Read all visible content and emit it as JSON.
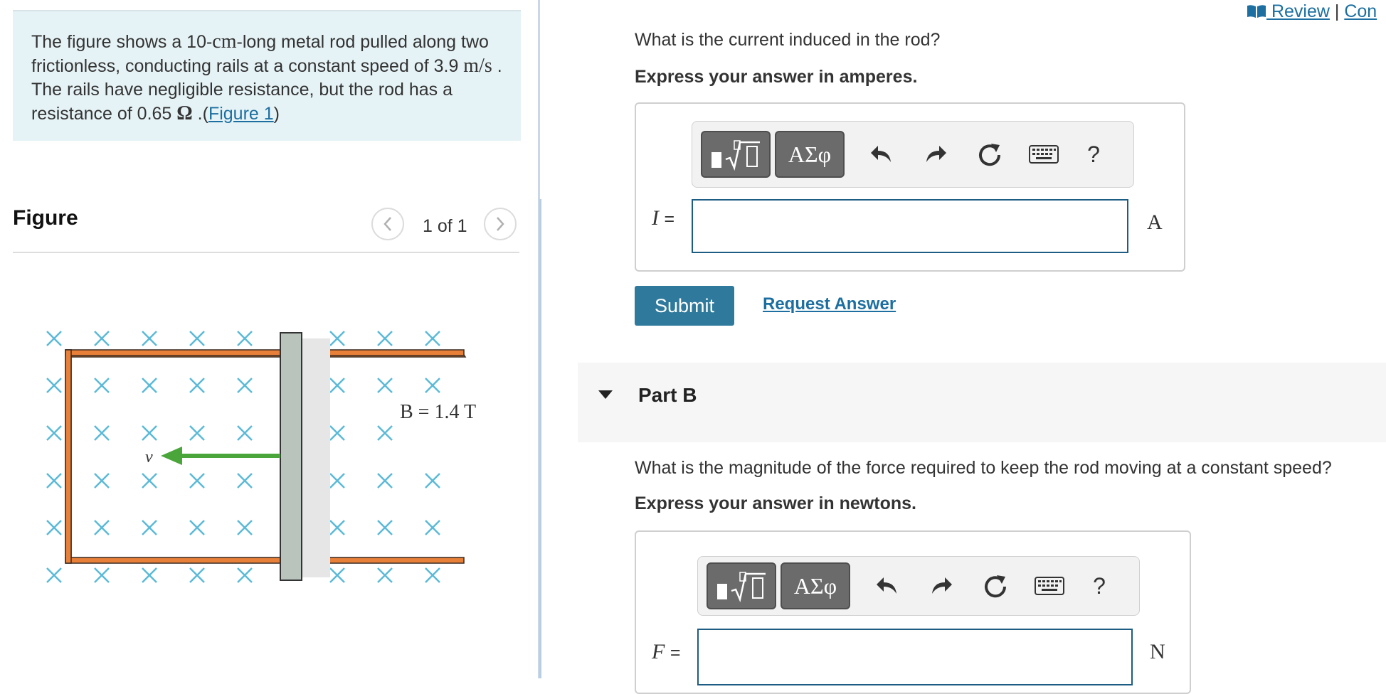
{
  "problem": {
    "text_1": "The figure shows a 10-",
    "unit_cm": "cm",
    "text_2": "-long metal rod pulled along two frictionless, conducting rails at a constant speed of 3.9 ",
    "unit_speed": "m/s",
    "text_3": " . The rails have negligible resistance, but the rod has a resistance of 0.65 ",
    "unit_ohm": "Ω",
    "text_4": " .(",
    "figure_link": "Figure 1",
    "text_5": ")"
  },
  "figure": {
    "heading": "Figure",
    "pager_text": "1 of 1",
    "prev_icon": "chevron-left-icon",
    "next_icon": "chevron-right-icon",
    "field_label": "B = 1.4 T",
    "velocity_label": "v",
    "colors": {
      "rail": "#e8803a",
      "rod": "#b9c4bd",
      "field_x": "#5bbad8",
      "arrow": "#4aa63a"
    }
  },
  "header": {
    "review_icon": "book-icon",
    "review_label": " Review",
    "separator": " | ",
    "constants_label": "Con"
  },
  "part_a": {
    "question": "What is the current induced in the rod?",
    "instruction": "Express your answer in amperes.",
    "variable": "I",
    "equals": "=",
    "unit": "A",
    "input_value": "",
    "submit_label": "Submit",
    "request_label": "Request Answer"
  },
  "part_b": {
    "title": "Part B",
    "question": "What is the magnitude of the force required to keep the rod moving at a constant speed?",
    "instruction": "Express your answer in newtons.",
    "variable": "F",
    "equals": "=",
    "unit": "N",
    "input_value": ""
  },
  "toolbar": {
    "templates_icon": "templates-radical-icon",
    "greek_label": "ΑΣφ",
    "undo_icon": "undo-icon",
    "redo_icon": "redo-icon",
    "reset_icon": "reset-icon",
    "keyboard_icon": "keyboard-icon",
    "help_label": "?"
  },
  "colors": {
    "accent": "#2f7a9c",
    "link": "#1c6fa0",
    "problem_bg": "#e6f3f6"
  }
}
